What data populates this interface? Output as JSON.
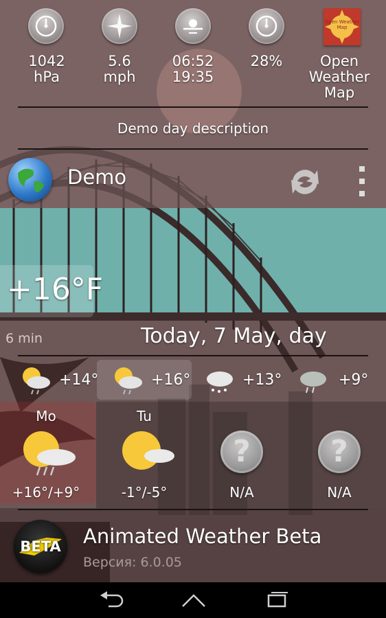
{
  "stats": [
    {
      "icon": "barometer-icon",
      "line1": "1042",
      "line2": "hPa"
    },
    {
      "icon": "wind-compass-icon",
      "line1": "5.6",
      "line2": "mph"
    },
    {
      "icon": "sunrise-sunset-icon",
      "line1": "06:52",
      "line2": "19:35"
    },
    {
      "icon": "humidity-icon",
      "line1": "28%",
      "line2": ""
    },
    {
      "icon": "open-weather-map-logo",
      "line1": "Open",
      "line2": "Weather",
      "line3": "Map"
    }
  ],
  "owm_logo_text": "Open Weather Map",
  "day_description": "Demo day description",
  "location": {
    "name": "Demo"
  },
  "current": {
    "temperature": "+16°F",
    "updated": "6 min",
    "date_label": "Today, 7 May, day"
  },
  "hourly": [
    {
      "icon": "sun-cloud-rain-icon",
      "temp": "+14°"
    },
    {
      "icon": "sun-cloud-rain-icon",
      "temp": "+16°"
    },
    {
      "icon": "cloud-snow-icon",
      "temp": "+13°"
    },
    {
      "icon": "cloud-rain-icon",
      "temp": "+9°"
    }
  ],
  "daily": [
    {
      "day": "Mo",
      "icon": "sun-cloud-rain-icon",
      "range": "+16°/+9°"
    },
    {
      "day": "Tu",
      "icon": "sun-cloud-icon",
      "range": "-1°/-5°"
    },
    {
      "day": "",
      "icon": "unknown-weather-icon",
      "range": "N/A"
    },
    {
      "day": "",
      "icon": "unknown-weather-icon",
      "range": "N/A"
    }
  ],
  "app": {
    "name": "Animated Weather Beta",
    "version": "Версия: 6.0.05",
    "badge": "BETA"
  },
  "colors": {
    "tint": "#7a4f4f",
    "sky": "#6fb0ab",
    "accent": "#c0392b"
  }
}
